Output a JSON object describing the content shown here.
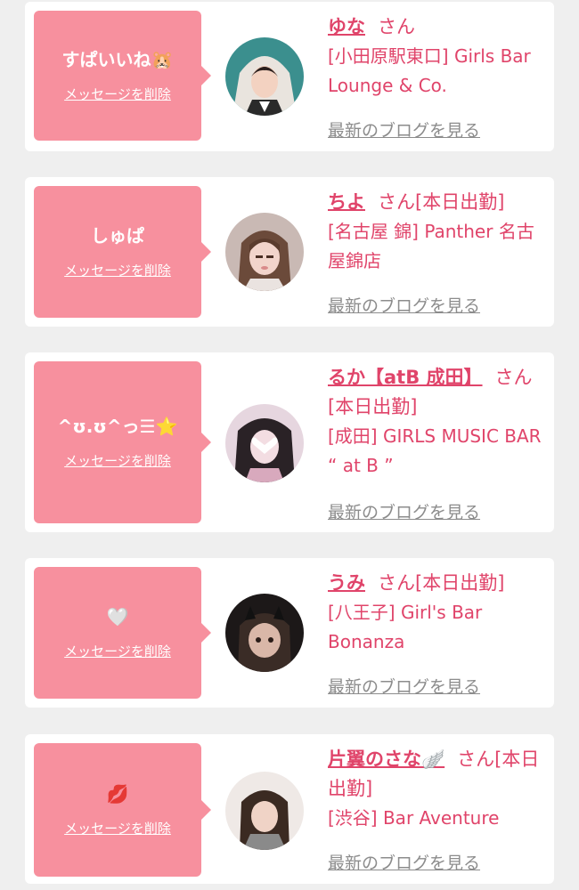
{
  "delete_label": "メッセージを削除",
  "blog_label": "最新のブログを見る",
  "san_label": "さん",
  "colors": {
    "bubble": "#f7909e",
    "accent": "#e0446a",
    "link_gray": "#8c8c8c",
    "background": "#efefef"
  },
  "items": [
    {
      "message": "すぱいいね🐹",
      "name": "ゆな",
      "san_suffix": "",
      "shop": "[小田原駅東口] Girls Bar Lounge & Co."
    },
    {
      "message": "しゅぱ",
      "name": "ちよ",
      "san_suffix": "[本日出勤]",
      "shop": "[名古屋 錦] Panther 名古屋錦店"
    },
    {
      "message": "^ʊ.ʊ^っ☰⭐",
      "name": "るか【atB 成田】",
      "san_suffix": "[本日出勤]",
      "shop": "[成田] GIRLS MUSIC BAR “ at B ”"
    },
    {
      "message": "🤍",
      "name": "うみ",
      "san_suffix": "[本日出勤]",
      "shop": "[八王子] Girl's Bar Bonanza"
    },
    {
      "message": "💋",
      "name": "片翼のさな🪽",
      "san_suffix": "[本日出勤]",
      "shop": "[渋谷] Bar Aventure"
    }
  ]
}
